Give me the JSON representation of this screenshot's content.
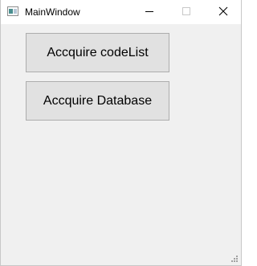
{
  "window": {
    "title": "MainWindow",
    "icon": "window-app-icon"
  },
  "caption": {
    "minimize_icon": "minimize-icon",
    "maximize_icon": "maximize-icon",
    "close_icon": "close-icon"
  },
  "buttons": [
    {
      "label": "Accquire codeList"
    },
    {
      "label": "Accquire Database"
    }
  ],
  "colors": {
    "background": "#f0f0f0",
    "titlebar": "#ffffff",
    "button_face": "#e1e1e1",
    "button_border": "#adadad"
  }
}
